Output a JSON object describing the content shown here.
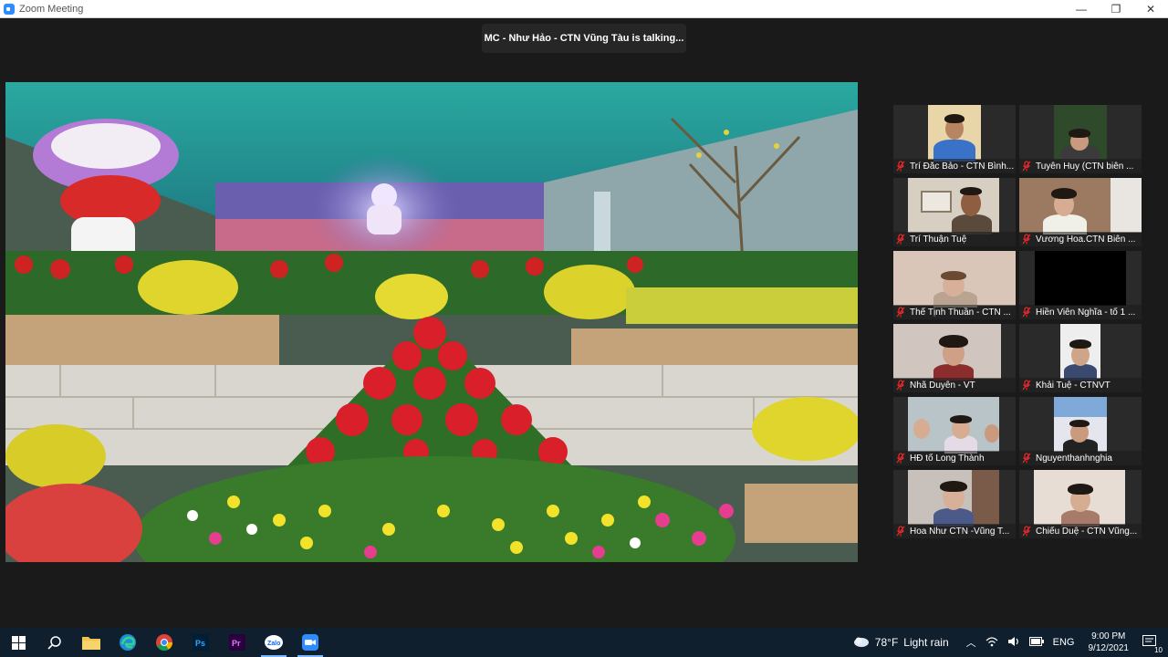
{
  "window": {
    "title": "Zoom Meeting",
    "minimize": "—",
    "maximize": "❐",
    "close": "✕"
  },
  "talking_banner": "MC - Như Hảo - CTN Vũng Tàu is talking...",
  "participants": [
    {
      "name": "Trí Đắc Bảo - CTN Bình...",
      "muted": true,
      "bg": "#e9d6a8",
      "skin": "#b88563",
      "shirt": "#3a72c8"
    },
    {
      "name": "Tuyên Huy (CTN biên ...",
      "muted": true,
      "bg": "#2f4a2a",
      "skin": "#c99a7e",
      "shirt": "#3b3b3b"
    },
    {
      "name": "Trí Thuận Tuệ",
      "muted": true,
      "bg": "#d7d0c2",
      "skin": "#8f5e41",
      "shirt": "#5a4a3c"
    },
    {
      "name": "Vương Hoa.CTN Biên ...",
      "muted": true,
      "bg": "#9c7a62",
      "skin": "#d6ad92",
      "shirt": "#f0efe8"
    },
    {
      "name": "Thể Tịnh Thuần - CTN ...",
      "muted": true,
      "bg": "#d9c6b8",
      "skin": "#d8b09a",
      "shirt": "#b9a492"
    },
    {
      "name": "Hiền Viên Nghĩa - tổ 1 ...",
      "muted": true,
      "bg": "#000000",
      "skin": "",
      "shirt": ""
    },
    {
      "name": "Nhã Duyên - VT",
      "muted": true,
      "bg": "#d0c6bf",
      "skin": "#cf9f86",
      "shirt": "#8c2d2d"
    },
    {
      "name": "Khải Tuệ - CTNVT",
      "muted": true,
      "bg": "#eeeeee",
      "skin": "#cfa58a",
      "shirt": "#3a4a6e"
    },
    {
      "name": "HĐ tổ Long Thành",
      "muted": true,
      "bg": "#b9c4c8",
      "skin": "#d6ad92",
      "shirt": "#e4dbe7"
    },
    {
      "name": "Nguyenthanhnghia",
      "muted": true,
      "bg": "#e5e5ee",
      "skin": "#c99a7e",
      "shirt": "#222222"
    },
    {
      "name": "Hoa Như CTN -Vũng T...",
      "muted": true,
      "bg": "#c8c0ba",
      "skin": "#d8b09a",
      "shirt": "#4c5a8a"
    },
    {
      "name": "Chiếu Duệ - CTN Vũng...",
      "muted": true,
      "bg": "#e8ddd4",
      "skin": "#d6ad92",
      "shirt": "#a77a6a"
    }
  ],
  "taskbar": {
    "weather_temp": "78°F",
    "weather_desc": "Light rain",
    "lang": "ENG",
    "time": "9:00 PM",
    "date": "9/12/2021",
    "notification_count": "10",
    "apps": [
      "windows-start",
      "search",
      "file-explorer",
      "edge",
      "chrome",
      "photoshop",
      "premiere",
      "zalo",
      "zoom"
    ]
  },
  "colors": {
    "taskbar_bg": "#0f1f2e",
    "zoom_blue": "#2d8cff",
    "mute_red": "#e02828"
  }
}
